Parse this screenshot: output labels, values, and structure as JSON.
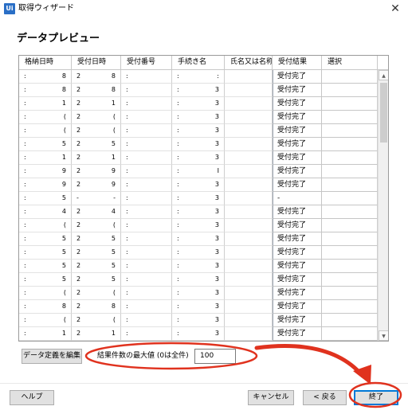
{
  "window": {
    "app_icon_text": "Ui",
    "title": "取得ウィザード",
    "close_glyph": "✕"
  },
  "heading": "データプレビュー",
  "grid": {
    "columns": [
      "格納日時",
      "受付日時",
      "受付番号",
      "手続き名",
      "氏名又は名称",
      "受付結果",
      "選択"
    ],
    "result_values": [
      "受付完了",
      "受付完了",
      "受付完了",
      "受付完了",
      "受付完了",
      "受付完了",
      "受付完了",
      "受付完了",
      "受付完了",
      "-",
      "受付完了",
      "受付完了",
      "受付完了",
      "受付完了",
      "受付完了",
      "受付完了",
      "受付完了",
      "受付完了",
      "受付完了",
      "受付完了"
    ],
    "rows": [
      [
        [
          ":",
          "8"
        ],
        [
          "2",
          "8"
        ],
        [
          ":",
          ""
        ],
        [
          ":",
          ":"
        ],
        [
          "",
          ""
        ]
      ],
      [
        [
          ":",
          "8"
        ],
        [
          "2",
          "8"
        ],
        [
          ":",
          ""
        ],
        [
          ":",
          "3"
        ],
        [
          "",
          ""
        ]
      ],
      [
        [
          ":",
          "1"
        ],
        [
          "2",
          "1"
        ],
        [
          ":",
          ""
        ],
        [
          ":",
          "3"
        ],
        [
          "",
          ""
        ]
      ],
      [
        [
          ":",
          "("
        ],
        [
          "2",
          "("
        ],
        [
          ":",
          ""
        ],
        [
          ":",
          "3"
        ],
        [
          "",
          ""
        ]
      ],
      [
        [
          ":",
          "("
        ],
        [
          "2",
          "("
        ],
        [
          ":",
          ""
        ],
        [
          ":",
          "3"
        ],
        [
          "",
          ""
        ]
      ],
      [
        [
          ":",
          "5"
        ],
        [
          "2",
          "5"
        ],
        [
          ":",
          ""
        ],
        [
          ":",
          "3"
        ],
        [
          "",
          ""
        ]
      ],
      [
        [
          ":",
          "1"
        ],
        [
          "2",
          "1"
        ],
        [
          ":",
          ""
        ],
        [
          ":",
          "3"
        ],
        [
          "",
          ""
        ]
      ],
      [
        [
          ":",
          "9"
        ],
        [
          "2",
          "9"
        ],
        [
          ":",
          ""
        ],
        [
          ":",
          "I"
        ],
        [
          "",
          ""
        ]
      ],
      [
        [
          ":",
          "9"
        ],
        [
          "2",
          "9"
        ],
        [
          ":",
          ""
        ],
        [
          ":",
          "3"
        ],
        [
          "",
          ""
        ]
      ],
      [
        [
          ":",
          "5"
        ],
        [
          "-",
          "-"
        ],
        [
          ":",
          ""
        ],
        [
          ":",
          "3"
        ],
        [
          "",
          ""
        ]
      ],
      [
        [
          ":",
          "4"
        ],
        [
          "2",
          "4"
        ],
        [
          ":",
          ""
        ],
        [
          ":",
          "3"
        ],
        [
          "",
          ""
        ]
      ],
      [
        [
          ":",
          "("
        ],
        [
          "2",
          "("
        ],
        [
          ":",
          ""
        ],
        [
          ":",
          "3"
        ],
        [
          "",
          ""
        ]
      ],
      [
        [
          ":",
          "5"
        ],
        [
          "2",
          "5"
        ],
        [
          ":",
          ""
        ],
        [
          ":",
          "3"
        ],
        [
          "",
          ""
        ]
      ],
      [
        [
          ":",
          "5"
        ],
        [
          "2",
          "5"
        ],
        [
          ":",
          ""
        ],
        [
          ":",
          "3"
        ],
        [
          "",
          ""
        ]
      ],
      [
        [
          ":",
          "5"
        ],
        [
          "2",
          "5"
        ],
        [
          ":",
          ""
        ],
        [
          ":",
          "3"
        ],
        [
          "",
          ""
        ]
      ],
      [
        [
          ":",
          "5"
        ],
        [
          "2",
          "5"
        ],
        [
          ":",
          ""
        ],
        [
          ":",
          "3"
        ],
        [
          "",
          ""
        ]
      ],
      [
        [
          ":",
          "("
        ],
        [
          "2",
          "("
        ],
        [
          ":",
          ""
        ],
        [
          ":",
          "3"
        ],
        [
          "",
          ""
        ]
      ],
      [
        [
          ":",
          "8"
        ],
        [
          "2",
          "8"
        ],
        [
          ":",
          ""
        ],
        [
          ":",
          "3"
        ],
        [
          "",
          ""
        ]
      ],
      [
        [
          ":",
          "("
        ],
        [
          "2",
          "("
        ],
        [
          ":",
          ""
        ],
        [
          ":",
          "3"
        ],
        [
          "",
          ""
        ]
      ],
      [
        [
          ":",
          "1"
        ],
        [
          "2",
          "1"
        ],
        [
          ":",
          ""
        ],
        [
          ":",
          "3"
        ],
        [
          "",
          ""
        ]
      ]
    ],
    "scroll_up_glyph": "▲",
    "scroll_down_glyph": "▼"
  },
  "controls": {
    "edit_button": "データ定義を編集",
    "max_label": "結果件数の最大値 (0は全件)",
    "max_value": "100"
  },
  "footer": {
    "help": "ヘルプ",
    "cancel": "キャンセル",
    "back": "< 戻る",
    "finish": "終了"
  },
  "colors": {
    "accent": "#0078d7",
    "annotation": "#e0321e",
    "app_icon": "#2a6fc6"
  }
}
